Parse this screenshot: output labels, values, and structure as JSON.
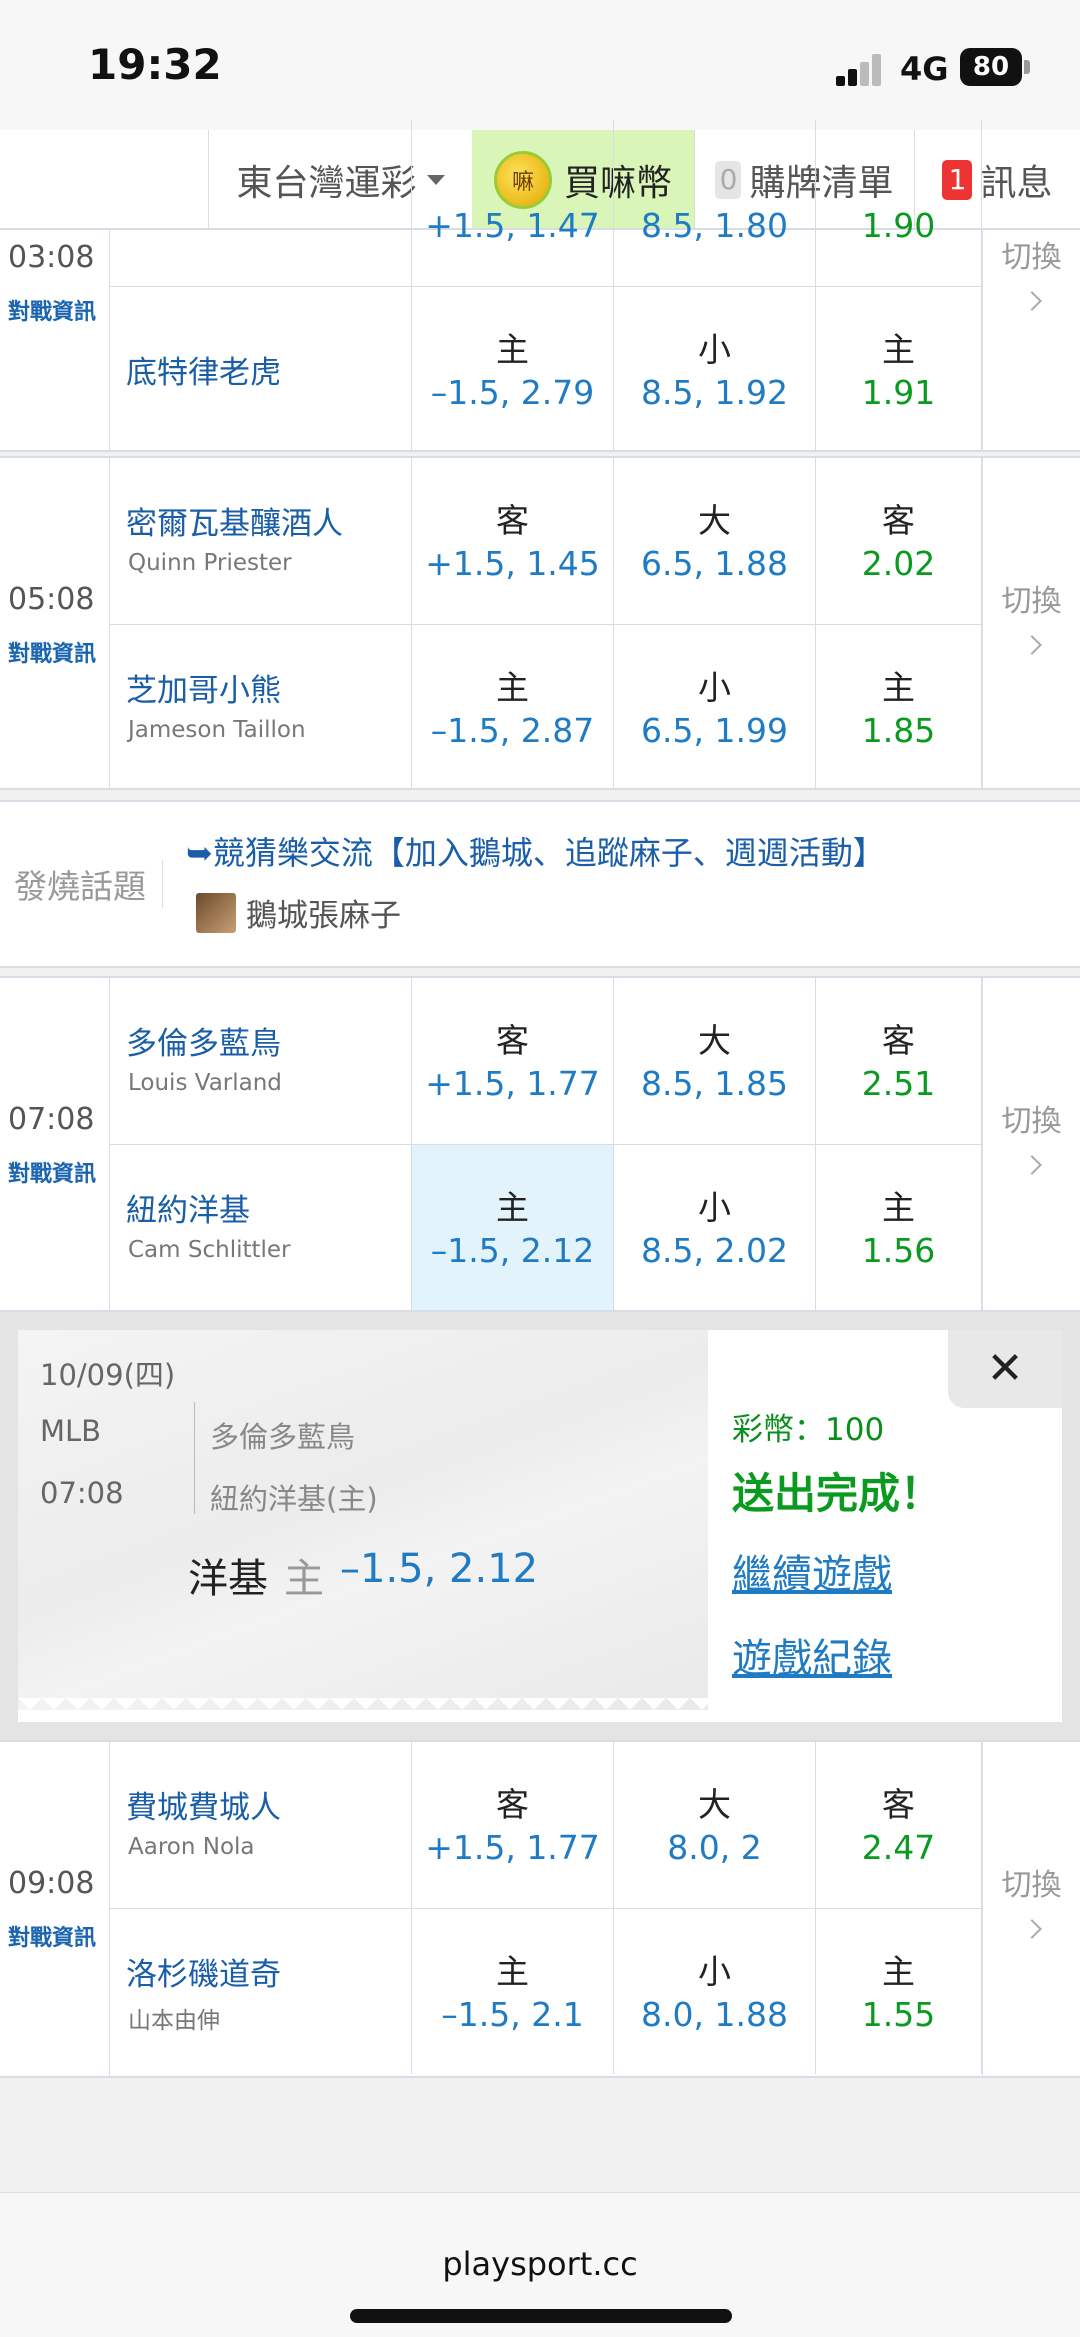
{
  "status_bar": {
    "time": "19:32",
    "network": "4G",
    "battery": "80"
  },
  "nav": {
    "region": "東台灣運彩",
    "buy_coin": "買嘛幣",
    "coin_glyph": "嘛",
    "cart_count": "0",
    "cart_label": "購牌清單",
    "msg_count": "1",
    "msg_label": "訊息"
  },
  "games": [
    {
      "time": "03:08",
      "info": "對戰資訊",
      "switch": "切換",
      "away": {
        "name": "",
        "pitcher": "",
        "spread_label": "",
        "spread": "+1.5, 1.47",
        "total_label": "",
        "total": "8.5, 1.80",
        "ml_label": "",
        "ml": "1.90"
      },
      "home": {
        "name": "底特律老虎",
        "pitcher": "",
        "spread_label": "主",
        "spread": "–1.5, 2.79",
        "total_label": "小",
        "total": "8.5, 1.92",
        "ml_label": "主",
        "ml": "1.91"
      }
    },
    {
      "time": "05:08",
      "info": "對戰資訊",
      "switch": "切換",
      "away": {
        "name": "密爾瓦基釀酒人",
        "pitcher": "Quinn Priester",
        "spread_label": "客",
        "spread": "+1.5, 1.45",
        "total_label": "大",
        "total": "6.5, 1.88",
        "ml_label": "客",
        "ml": "2.02"
      },
      "home": {
        "name": "芝加哥小熊",
        "pitcher": "Jameson Taillon",
        "spread_label": "主",
        "spread": "–1.5, 2.87",
        "total_label": "小",
        "total": "6.5, 1.99",
        "ml_label": "主",
        "ml": "1.85"
      }
    },
    {
      "time": "07:08",
      "info": "對戰資訊",
      "switch": "切換",
      "away": {
        "name": "多倫多藍鳥",
        "pitcher": "Louis Varland",
        "spread_label": "客",
        "spread": "+1.5, 1.77",
        "total_label": "大",
        "total": "8.5, 1.85",
        "ml_label": "客",
        "ml": "2.51"
      },
      "home": {
        "name": "紐約洋基",
        "pitcher": "Cam Schlittler",
        "spread_label": "主",
        "spread": "–1.5, 2.12",
        "total_label": "小",
        "total": "8.5, 2.02",
        "ml_label": "主",
        "ml": "1.56"
      }
    },
    {
      "time": "09:08",
      "info": "對戰資訊",
      "switch": "切換",
      "away": {
        "name": "費城費城人",
        "pitcher": "Aaron Nola",
        "spread_label": "客",
        "spread": "+1.5, 1.77",
        "total_label": "大",
        "total": "8.0, 2",
        "ml_label": "客",
        "ml": "2.47"
      },
      "home": {
        "name": "洛杉磯道奇",
        "pitcher": "山本由伸",
        "spread_label": "主",
        "spread": "–1.5, 2.1",
        "total_label": "小",
        "total": "8.0, 1.88",
        "ml_label": "主",
        "ml": "1.55"
      }
    }
  ],
  "topic": {
    "label": "發燒話題",
    "link": "➥競猜樂交流【加入鵝城、追蹤麻子、週週活動】",
    "author": "鵝城張麻子"
  },
  "confirmation": {
    "date": "10/09(四)",
    "league": "MLB",
    "time": "07:08",
    "away": "多倫多藍鳥",
    "home": "紐約洋基(主)",
    "pick_team": "洋基",
    "pick_side": "主",
    "pick_odds": "–1.5, 2.12",
    "coins": "彩幣：100",
    "done": "送出完成！",
    "continue": "繼續遊戲",
    "records": "遊戲紀錄",
    "close": "✕"
  },
  "footer": {
    "url": "playsport.cc"
  }
}
